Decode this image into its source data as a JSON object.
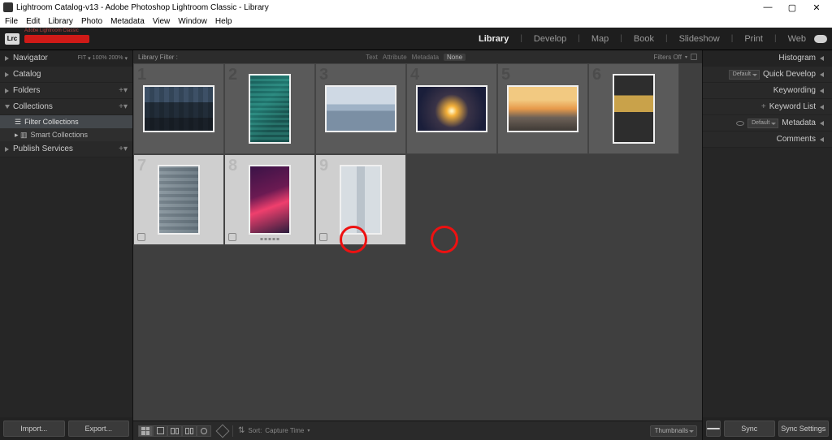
{
  "window": {
    "title": "Lightroom Catalog-v13 - Adobe Photoshop Lightroom Classic - Library",
    "buttons": {
      "min": "—",
      "max": "▢",
      "close": "✕"
    }
  },
  "menu": [
    "File",
    "Edit",
    "Library",
    "Photo",
    "Metadata",
    "View",
    "Window",
    "Help"
  ],
  "lr": {
    "badge": "Lrc",
    "redbar_label": "Adobe Lightroom Classic",
    "modules": [
      "Library",
      "Develop",
      "Map",
      "Book",
      "Slideshow",
      "Print",
      "Web"
    ],
    "active_module": "Library"
  },
  "left": {
    "navigator": {
      "label": "Navigator",
      "fit": "FIT",
      "pct1": "100%",
      "pct2": "200%"
    },
    "catalog": "Catalog",
    "folders": "Folders",
    "collections": {
      "label": "Collections",
      "filter": "Filter Collections",
      "smart": "Smart Collections"
    },
    "publish": "Publish Services",
    "buttons": {
      "import": "Import...",
      "export": "Export..."
    }
  },
  "right": {
    "histogram": "Histogram",
    "quick": {
      "label": "Quick Develop",
      "preset": "Default"
    },
    "keywording": "Keywording",
    "keywordlist": "Keyword List",
    "metadata": {
      "label": "Metadata",
      "preset": "Default"
    },
    "comments": "Comments",
    "sync": "Sync",
    "sync_settings": "Sync Settings"
  },
  "filter": {
    "label": "Library Filter :",
    "tabs": [
      "Text",
      "Attribute",
      "Metadata",
      "None"
    ],
    "active": "None",
    "right_label": "Filters Off"
  },
  "toolbar": {
    "sort_label": "Sort:",
    "sort_value": "Capture Time",
    "right_btn": "Thumbnails"
  },
  "thumbs": [
    {
      "n": "1",
      "orient": "ls",
      "cls": "p1",
      "sel": false
    },
    {
      "n": "2",
      "orient": "pt",
      "cls": "p2",
      "sel": false
    },
    {
      "n": "3",
      "orient": "ls",
      "cls": "p3",
      "sel": false
    },
    {
      "n": "4",
      "orient": "ls",
      "cls": "p4",
      "sel": false
    },
    {
      "n": "5",
      "orient": "ls",
      "cls": "p5",
      "sel": false
    },
    {
      "n": "6",
      "orient": "pt",
      "cls": "p6",
      "sel": false
    },
    {
      "n": "7",
      "orient": "pt",
      "cls": "p7",
      "sel": true
    },
    {
      "n": "8",
      "orient": "pt",
      "cls": "p8",
      "sel": true
    },
    {
      "n": "9",
      "orient": "pt",
      "cls": "p9",
      "sel": true
    }
  ]
}
